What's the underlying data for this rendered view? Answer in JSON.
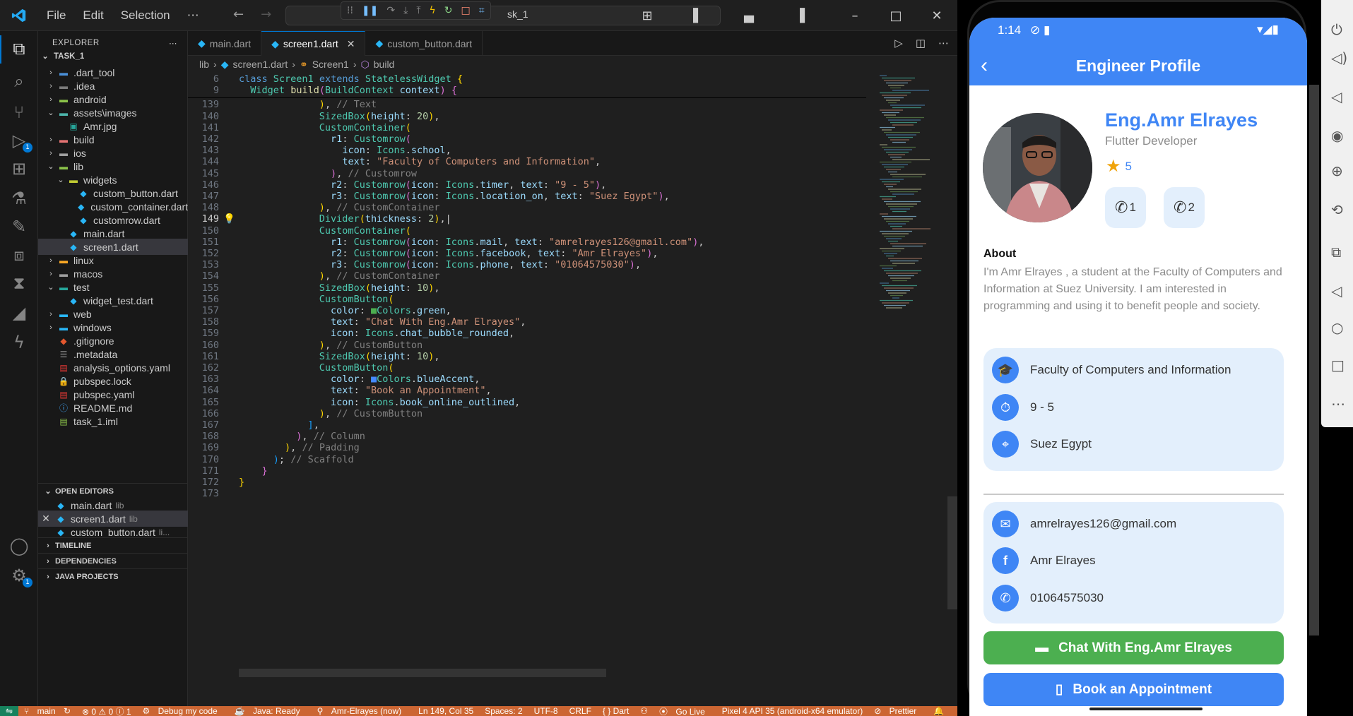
{
  "titlebar": {
    "menu": [
      "File",
      "Edit",
      "Selection",
      "⋯"
    ],
    "search_text": "sk_1",
    "window_buttons": [
      "–",
      "□",
      "✕"
    ]
  },
  "explorer": {
    "header": "EXPLORER",
    "root": "TASK_1",
    "items": [
      {
        "label": ".dart_tool",
        "indent": 1,
        "type": "folder",
        "open": false,
        "color": "#4a90d9"
      },
      {
        "label": ".idea",
        "indent": 1,
        "type": "folder",
        "open": false,
        "color": "#7b7b7b"
      },
      {
        "label": "android",
        "indent": 1,
        "type": "folder",
        "open": false,
        "color": "#8bc34a"
      },
      {
        "label": "assets\\images",
        "indent": 1,
        "type": "folder",
        "open": true,
        "color": "#4db6ac"
      },
      {
        "label": "Amr.jpg",
        "indent": 2,
        "type": "image",
        "color": "#26a69a"
      },
      {
        "label": "build",
        "indent": 1,
        "type": "folder",
        "open": false,
        "color": "#e57373"
      },
      {
        "label": "ios",
        "indent": 1,
        "type": "folder",
        "open": false,
        "color": "#9e9e9e"
      },
      {
        "label": "lib",
        "indent": 1,
        "type": "folder",
        "open": true,
        "color": "#8bc34a"
      },
      {
        "label": "widgets",
        "indent": 2,
        "type": "folder",
        "open": true,
        "color": "#c0ca33"
      },
      {
        "label": "custom_button.dart",
        "indent": 3,
        "type": "dart",
        "color": "#29b6f6"
      },
      {
        "label": "custom_container.dart",
        "indent": 3,
        "type": "dart",
        "color": "#29b6f6"
      },
      {
        "label": "customrow.dart",
        "indent": 3,
        "type": "dart",
        "color": "#29b6f6"
      },
      {
        "label": "main.dart",
        "indent": 2,
        "type": "dart",
        "color": "#29b6f6"
      },
      {
        "label": "screen1.dart",
        "indent": 2,
        "type": "dart",
        "color": "#29b6f6",
        "selected": true
      },
      {
        "label": "linux",
        "indent": 1,
        "type": "folder",
        "open": false,
        "color": "#f9a825"
      },
      {
        "label": "macos",
        "indent": 1,
        "type": "folder",
        "open": false,
        "color": "#9e9e9e"
      },
      {
        "label": "test",
        "indent": 1,
        "type": "folder",
        "open": true,
        "color": "#26a69a"
      },
      {
        "label": "widget_test.dart",
        "indent": 2,
        "type": "dart",
        "color": "#29b6f6"
      },
      {
        "label": "web",
        "indent": 1,
        "type": "folder",
        "open": false,
        "color": "#29b6f6"
      },
      {
        "label": "windows",
        "indent": 1,
        "type": "folder",
        "open": false,
        "color": "#29b6f6"
      },
      {
        "label": ".gitignore",
        "indent": 1,
        "type": "git",
        "color": "#e4572e"
      },
      {
        "label": ".metadata",
        "indent": 1,
        "type": "file",
        "color": "#9e9e9e"
      },
      {
        "label": "analysis_options.yaml",
        "indent": 1,
        "type": "yaml",
        "color": "#e53935"
      },
      {
        "label": "pubspec.lock",
        "indent": 1,
        "type": "lock",
        "color": "#fbc02d"
      },
      {
        "label": "pubspec.yaml",
        "indent": 1,
        "type": "yaml",
        "color": "#e53935"
      },
      {
        "label": "README.md",
        "indent": 1,
        "type": "info",
        "color": "#42a5f5"
      },
      {
        "label": "task_1.iml",
        "indent": 1,
        "type": "iml",
        "color": "#8bc34a"
      }
    ],
    "open_editors_title": "OPEN EDITORS",
    "open_editors": [
      {
        "name": "main.dart",
        "dir": "lib"
      },
      {
        "name": "screen1.dart",
        "dir": "lib"
      },
      {
        "name": "custom_button.dart",
        "dir": "li..."
      }
    ],
    "sections": [
      "TIMELINE",
      "DEPENDENCIES",
      "JAVA PROJECTS"
    ]
  },
  "tabs": [
    {
      "label": "main.dart",
      "active": false
    },
    {
      "label": "screen1.dart",
      "active": true
    },
    {
      "label": "custom_button.dart",
      "active": false
    }
  ],
  "breadcrumb": [
    "lib",
    "screen1.dart",
    "Screen1",
    "build"
  ],
  "status": {
    "branch": "main",
    "problems": "⊗ 0 ⚠ 0 ⓘ 1",
    "debug": "Debug my code",
    "java": "Java: Ready",
    "live_share": "Amr-Elrayes (now)",
    "position": "Ln 149, Col 35",
    "spaces": "Spaces: 2",
    "encoding": "UTF-8",
    "eol": "CRLF",
    "language": "{ } Dart",
    "golive": "Go Live",
    "device": "Pixel 4 API 35 (android-x64 emulator)",
    "prettier": "Prettier"
  },
  "phone": {
    "time": "1:14",
    "app_title": "Engineer Profile",
    "name": "Eng.Amr Elrayes",
    "role": "Flutter Developer",
    "rating": "5",
    "call1": "1",
    "call2": "2",
    "about_title": "About",
    "about_text": "I'm Amr Elrayes , a student at the Faculty of Computers and Information at Suez University. I am interested in programming and using it to benefit people and society.",
    "info": [
      "Faculty of Computers and Information",
      "9 - 5",
      "Suez Egypt"
    ],
    "contact": [
      "amrelrayes126@gmail.com",
      "Amr Elrayes",
      "01064575030"
    ],
    "chat_button": "Chat With Eng.Amr Elrayes",
    "book_button": "Book an Appointment",
    "colors": {
      "primary": "#3f86f5",
      "green": "#4caf50",
      "card": "#e3effc"
    }
  }
}
